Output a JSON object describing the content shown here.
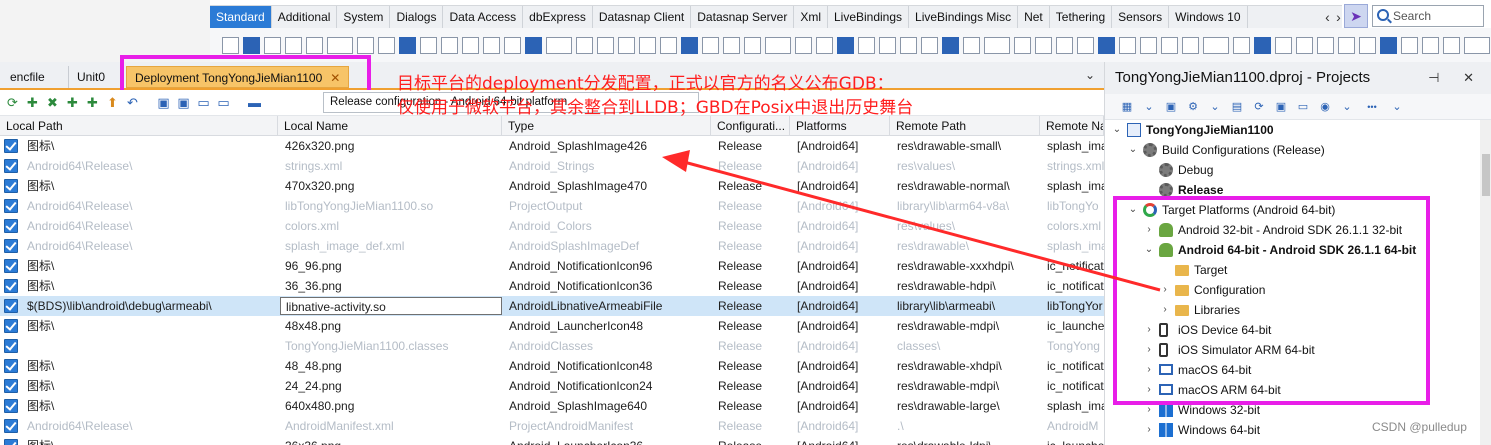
{
  "palette": {
    "tabs": [
      "Standard",
      "Additional",
      "System",
      "Dialogs",
      "Data Access",
      "dbExpress",
      "Datasnap Client",
      "Datasnap Server",
      "Xml",
      "LiveBindings",
      "LiveBindings Misc",
      "Net",
      "Tethering",
      "Sensors",
      "Windows 10"
    ],
    "active_tab": "Standard",
    "search_placeholder": "Search",
    "prev_glyph": "‹",
    "next_glyph": "›",
    "cursor_glyph": "➤"
  },
  "editor": {
    "tabs": [
      {
        "label": "encfile",
        "active": false
      },
      {
        "label": "Unit0",
        "active": false
      },
      {
        "label": "Deployment TongYongJieMian1100",
        "active": true
      }
    ],
    "close_glyph": "✕",
    "dropdown_glyph": "⌄"
  },
  "deployment": {
    "configuration": "Release configuration - Android 64-bit platform",
    "toolbar_glyphs": [
      "⟳",
      "✚",
      "✖",
      "✚",
      "✚",
      "⬆",
      "↶",
      "",
      "▣",
      "▣",
      "▭",
      "▭",
      "",
      "▬"
    ]
  },
  "annotation": {
    "line1": "目标平台的deployment分发配置，正式以官方的名义公布GDB：",
    "line2": "仅使用于微软平台，其余整合到LLDB；GBD在Posix中退出历史舞台"
  },
  "grid": {
    "columns": [
      "Local Path",
      "Local Name",
      "Type",
      "Configurati...",
      "Platforms",
      "Remote Path",
      "Remote Na"
    ],
    "rows": [
      {
        "dim": false,
        "selected": false,
        "cells": [
          "图标\\",
          "426x320.png",
          "Android_SplashImage426",
          "Release",
          "[Android64]",
          "res\\drawable-small\\",
          "splash_ima"
        ]
      },
      {
        "dim": true,
        "selected": false,
        "cells": [
          "Android64\\Release\\",
          "strings.xml",
          "Android_Strings",
          "Release",
          "[Android64]",
          "res\\values\\",
          "strings.xml"
        ]
      },
      {
        "dim": false,
        "selected": false,
        "cells": [
          "图标\\",
          "470x320.png",
          "Android_SplashImage470",
          "Release",
          "[Android64]",
          "res\\drawable-normal\\",
          "splash_ima"
        ]
      },
      {
        "dim": true,
        "selected": false,
        "cells": [
          "Android64\\Release\\",
          "libTongYongJieMian1100.so",
          "ProjectOutput",
          "Release",
          "[Android64]",
          "library\\lib\\arm64-v8a\\",
          "libTongYo"
        ]
      },
      {
        "dim": true,
        "selected": false,
        "cells": [
          "Android64\\Release\\",
          "colors.xml",
          "Android_Colors",
          "Release",
          "[Android64]",
          "res\\values\\",
          "colors.xml"
        ]
      },
      {
        "dim": true,
        "selected": false,
        "cells": [
          "Android64\\Release\\",
          "splash_image_def.xml",
          "AndroidSplashImageDef",
          "Release",
          "[Android64]",
          "res\\drawable\\",
          "splash_ima"
        ]
      },
      {
        "dim": false,
        "selected": false,
        "cells": [
          "图标\\",
          "96_96.png",
          "Android_NotificationIcon96",
          "Release",
          "[Android64]",
          "res\\drawable-xxxhdpi\\",
          "ic_notificat"
        ]
      },
      {
        "dim": false,
        "selected": false,
        "cells": [
          "图标\\",
          "36_36.png",
          "Android_NotificationIcon36",
          "Release",
          "[Android64]",
          "res\\drawable-hdpi\\",
          "ic_notificat"
        ]
      },
      {
        "dim": false,
        "selected": true,
        "cells": [
          "$(BDS)\\lib\\android\\debug\\armeabi\\",
          "libnative-activity.so",
          "AndroidLibnativeArmeabiFile",
          "Release",
          "[Android64]",
          "library\\lib\\armeabi\\",
          "libTongYor"
        ]
      },
      {
        "dim": false,
        "selected": false,
        "cells": [
          "图标\\",
          "48x48.png",
          "Android_LauncherIcon48",
          "Release",
          "[Android64]",
          "res\\drawable-mdpi\\",
          "ic_launche"
        ]
      },
      {
        "dim": true,
        "selected": false,
        "cells": [
          "",
          "TongYongJieMian1100.classes",
          "AndroidClasses",
          "Release",
          "[Android64]",
          "classes\\",
          "TongYong"
        ]
      },
      {
        "dim": false,
        "selected": false,
        "cells": [
          "图标\\",
          "48_48.png",
          "Android_NotificationIcon48",
          "Release",
          "[Android64]",
          "res\\drawable-xhdpi\\",
          "ic_notificat"
        ]
      },
      {
        "dim": false,
        "selected": false,
        "cells": [
          "图标\\",
          "24_24.png",
          "Android_NotificationIcon24",
          "Release",
          "[Android64]",
          "res\\drawable-mdpi\\",
          "ic_notificat"
        ]
      },
      {
        "dim": false,
        "selected": false,
        "cells": [
          "图标\\",
          "640x480.png",
          "Android_SplashImage640",
          "Release",
          "[Android64]",
          "res\\drawable-large\\",
          "splash_ima"
        ]
      },
      {
        "dim": true,
        "selected": false,
        "cells": [
          "Android64\\Release\\",
          "AndroidManifest.xml",
          "ProjectAndroidManifest",
          "Release",
          "[Android64]",
          ".\\",
          "AndroidM"
        ]
      },
      {
        "dim": false,
        "selected": false,
        "cells": [
          "图标\\",
          "36x36.png",
          "Android_LauncherIcon36",
          "Release",
          "[Android64]",
          "res\\drawable-ldpi\\",
          "ic_launche"
        ]
      }
    ]
  },
  "projects": {
    "title": "TongYongJieMian1100.dproj - Projects",
    "title_controls": "⊣ ✕",
    "toolbar_glyphs": [
      "▦",
      "⌄",
      "▣",
      "⚙",
      "⌄",
      "▤",
      "⟳",
      "▣",
      "▭",
      "◉",
      "⌄",
      "•••",
      "⌄"
    ],
    "tree": [
      {
        "label": "TongYongJieMian1100",
        "indent": 0,
        "arrow": "⌄",
        "icon": "proj",
        "bold": true
      },
      {
        "label": "Build Configurations (Release)",
        "indent": 1,
        "arrow": "⌄",
        "icon": "gear",
        "bold": false
      },
      {
        "label": "Debug",
        "indent": 2,
        "arrow": "",
        "icon": "gear",
        "bold": false
      },
      {
        "label": "Release",
        "indent": 2,
        "arrow": "",
        "icon": "gear",
        "bold": true
      },
      {
        "label": "Target Platforms (Android 64-bit)",
        "indent": 1,
        "arrow": "⌄",
        "icon": "target",
        "bold": false
      },
      {
        "label": "Android 32-bit - Android SDK 26.1.1 32-bit",
        "indent": 2,
        "arrow": "›",
        "icon": "android",
        "bold": false
      },
      {
        "label": "Android 64-bit - Android SDK 26.1.1 64-bit",
        "indent": 2,
        "arrow": "⌄",
        "icon": "android",
        "bold": true
      },
      {
        "label": "Target",
        "indent": 3,
        "arrow": "",
        "icon": "folder",
        "bold": false
      },
      {
        "label": "Configuration",
        "indent": 3,
        "arrow": "›",
        "icon": "folder",
        "bold": false
      },
      {
        "label": "Libraries",
        "indent": 3,
        "arrow": "›",
        "icon": "folder",
        "bold": false
      },
      {
        "label": "iOS Device 64-bit",
        "indent": 2,
        "arrow": "›",
        "icon": "phone",
        "bold": false
      },
      {
        "label": "iOS Simulator ARM 64-bit",
        "indent": 2,
        "arrow": "›",
        "icon": "phone",
        "bold": false
      },
      {
        "label": "macOS 64-bit",
        "indent": 2,
        "arrow": "›",
        "icon": "monitor",
        "bold": false
      },
      {
        "label": "macOS ARM 64-bit",
        "indent": 2,
        "arrow": "›",
        "icon": "monitor",
        "bold": false
      },
      {
        "label": "Windows 32-bit",
        "indent": 2,
        "arrow": "›",
        "icon": "windows",
        "bold": false
      },
      {
        "label": "Windows 64-bit",
        "indent": 2,
        "arrow": "›",
        "icon": "windows",
        "bold": false
      }
    ]
  },
  "watermark": "CSDN @pulledup",
  "colors": {
    "accent": "#2b7bd6",
    "highlight_box": "#e81ee8",
    "annotation_text": "#ff1e1e",
    "active_editor_tab": "#f7c468"
  }
}
